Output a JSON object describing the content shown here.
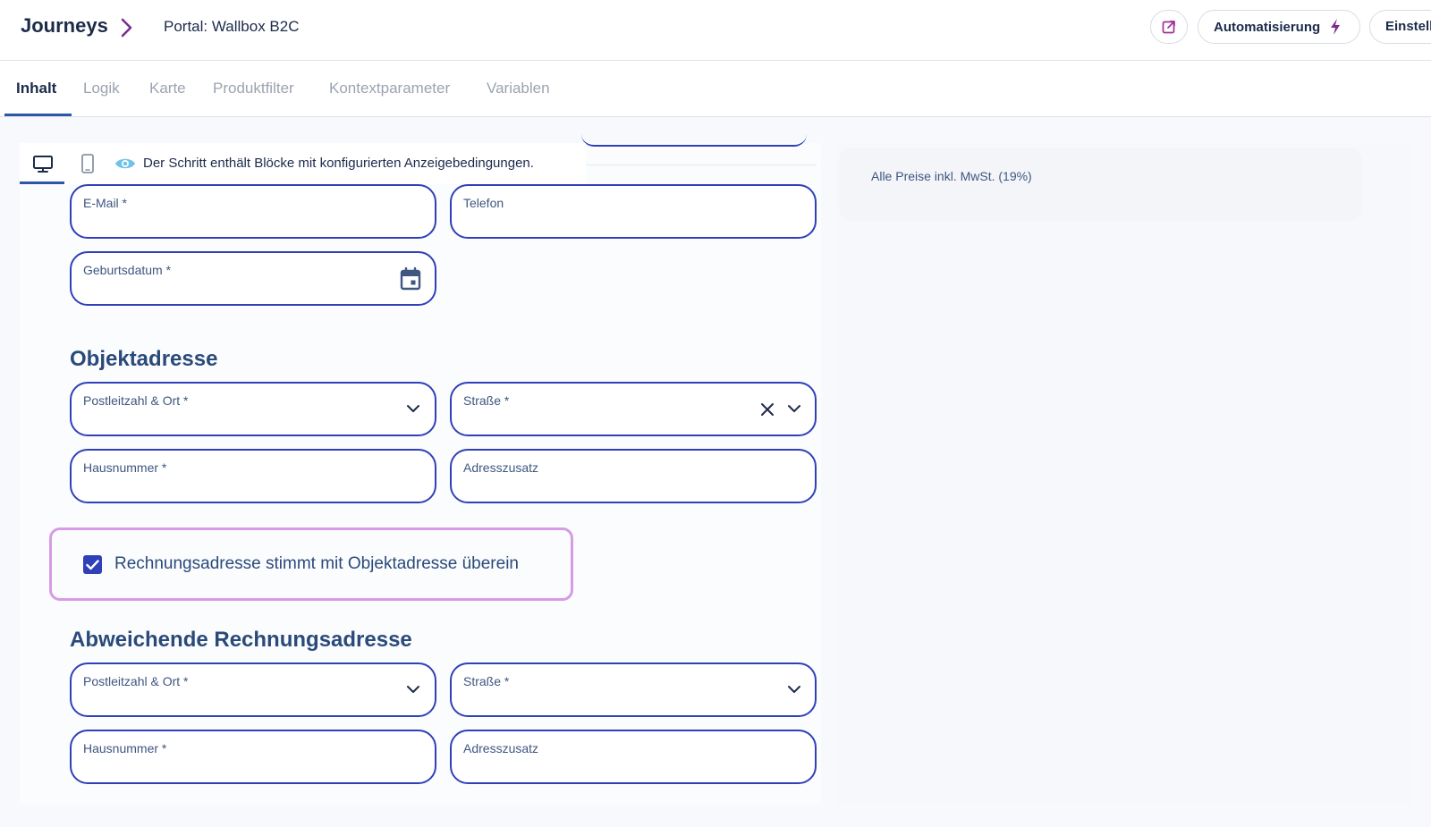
{
  "header": {
    "brand": "Journeys",
    "portal": "Portal: Wallbox B2C",
    "automation_label": "Automatisierung",
    "settings_label": "Einstell"
  },
  "tabs": [
    {
      "label": "Inhalt",
      "active": true
    },
    {
      "label": "Logik",
      "active": false
    },
    {
      "label": "Karte",
      "active": false
    },
    {
      "label": "Produktfilter",
      "active": false
    },
    {
      "label": "Kontextparameter",
      "active": false
    },
    {
      "label": "Variablen",
      "active": false
    }
  ],
  "toolbar": {
    "condition_notice": "Der Schritt enthält Blöcke mit konfigurierten Anzeigebedingungen."
  },
  "sidebar": {
    "price_note": "Alle Preise inkl. MwSt. (19%)"
  },
  "contact_fields": {
    "email_label": "E-Mail *",
    "phone_label": "Telefon",
    "birthdate_label": "Geburtsdatum *"
  },
  "object_address": {
    "title": "Objektadresse",
    "zip_city_label": "Postleitzahl & Ort *",
    "street_label": "Straße *",
    "house_number_label": "Hausnummer *",
    "address_suffix_label": "Adresszusatz"
  },
  "billing_checkbox": {
    "label": "Rechnungsadresse stimmt mit Objektadresse überein",
    "checked": true
  },
  "billing_address": {
    "title": "Abweichende Rechnungsadresse",
    "zip_city_label": "Postleitzahl & Ort *",
    "street_label": "Straße *",
    "house_number_label": "Hausnummer *",
    "address_suffix_label": "Adresszusatz"
  },
  "colors": {
    "accent": "#2f40b8",
    "highlight": "#d79be6",
    "automation_bolt": "#7b2d8e"
  }
}
